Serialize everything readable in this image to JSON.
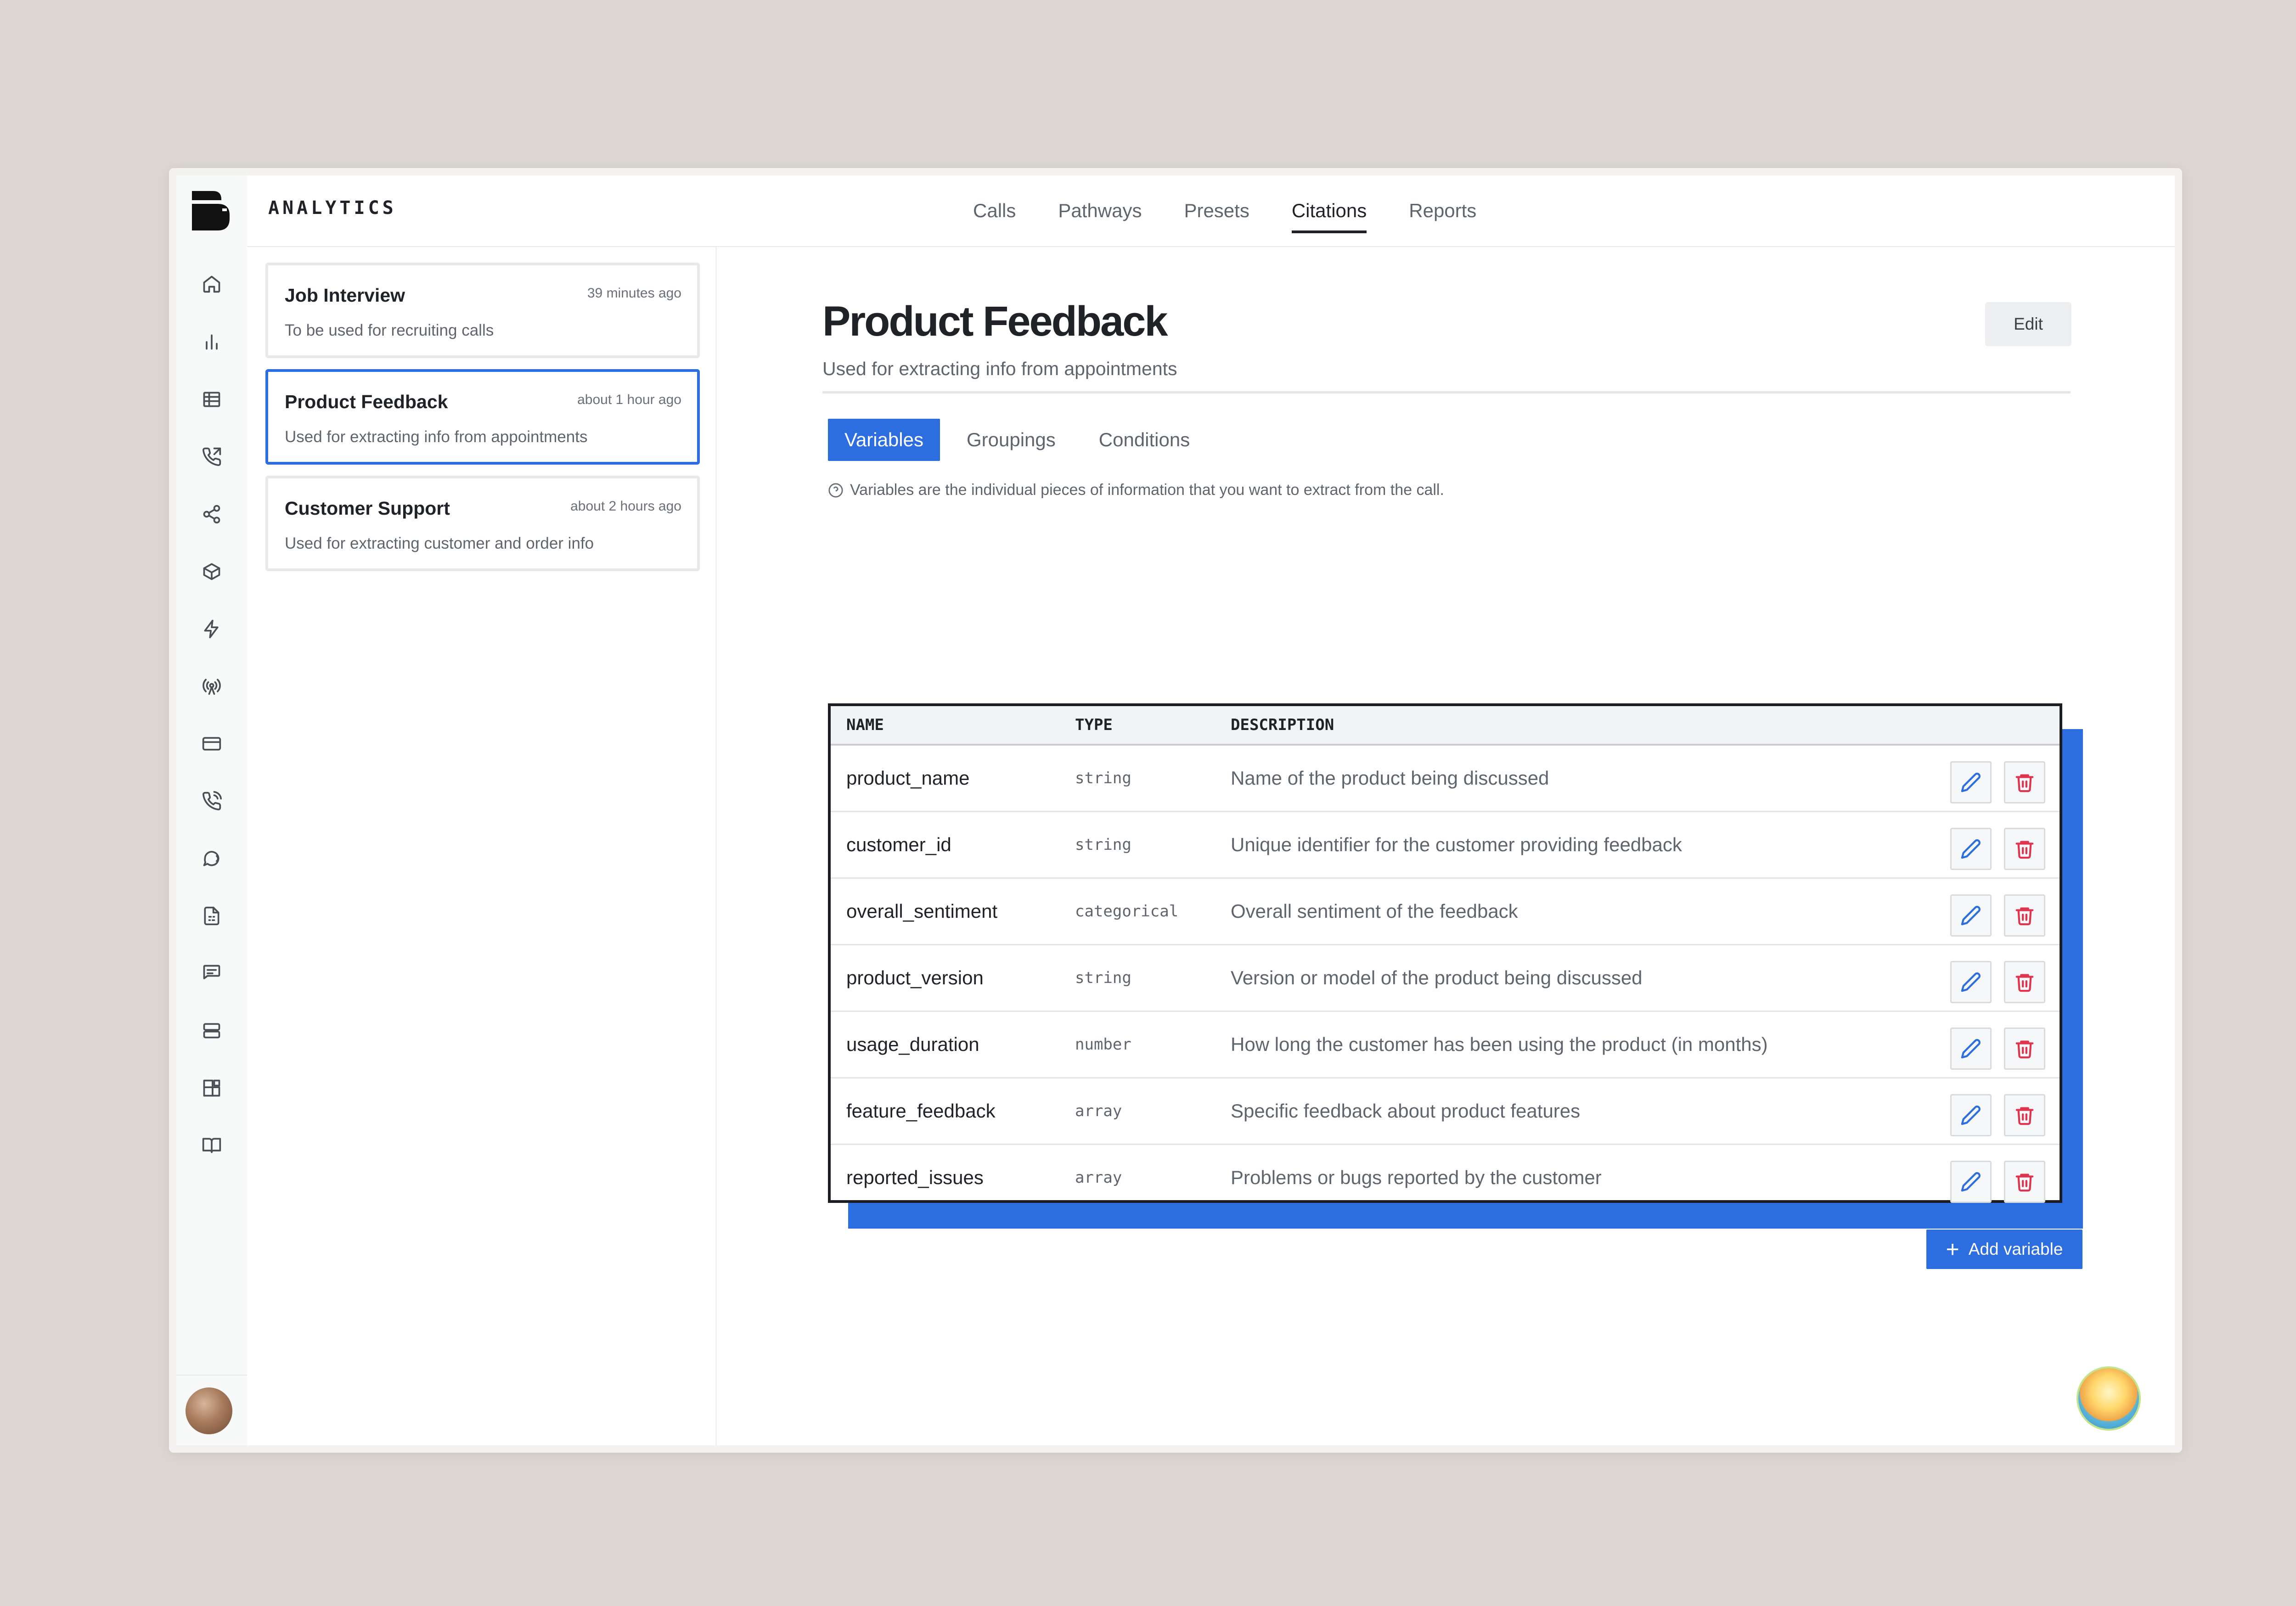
{
  "app": {
    "name": "ANALYTICS",
    "nav": [
      "Calls",
      "Pathways",
      "Presets",
      "Citations",
      "Reports"
    ],
    "nav_active": "Citations"
  },
  "rail_icons": [
    "home-icon",
    "bar-chart-icon",
    "table-icon",
    "phone-forward-icon",
    "share-icon",
    "box-icon",
    "lightning-icon",
    "broadcast-icon",
    "credit-card-icon",
    "phone-call-icon",
    "chat-bubble-icon",
    "file-scan-icon",
    "message-square-icon",
    "server-icon",
    "blocks-icon",
    "book-open-icon"
  ],
  "presets": [
    {
      "title": "Job Interview",
      "time": "39 minutes ago",
      "desc": "To be used for recruiting calls"
    },
    {
      "title": "Product Feedback",
      "time": "about 1 hour ago",
      "desc": "Used for extracting info from appointments"
    },
    {
      "title": "Customer Support",
      "time": "about 2 hours ago",
      "desc": "Used for extracting customer and order info"
    }
  ],
  "selected_preset": 1,
  "main": {
    "title": "Product Feedback",
    "subtitle": "Used for extracting info from appointments",
    "edit_label": "Edit",
    "tabs": [
      "Variables",
      "Groupings",
      "Conditions"
    ],
    "tab_active": "Variables",
    "hint": "Variables are the individual pieces of information that you want to extract from the call.",
    "add_label": "Add variable"
  },
  "table": {
    "headers": {
      "name": "NAME",
      "type": "TYPE",
      "description": "DESCRIPTION"
    },
    "rows": [
      {
        "name": "product_name",
        "type": "string",
        "description": "Name of the product being discussed"
      },
      {
        "name": "customer_id",
        "type": "string",
        "description": "Unique identifier for the customer providing feedback"
      },
      {
        "name": "overall_sentiment",
        "type": "categorical",
        "description": "Overall sentiment of the feedback"
      },
      {
        "name": "product_version",
        "type": "string",
        "description": "Version or model of the product being discussed"
      },
      {
        "name": "usage_duration",
        "type": "number",
        "description": "How long the customer has been using the product (in months)"
      },
      {
        "name": "feature_feedback",
        "type": "array",
        "description": "Specific feedback about product features"
      },
      {
        "name": "reported_issues",
        "type": "array",
        "description": "Problems or bugs reported by the customer"
      }
    ]
  },
  "colors": {
    "accent": "#2c6ee0",
    "danger": "#e0344e",
    "background": "#dcd7d1"
  }
}
